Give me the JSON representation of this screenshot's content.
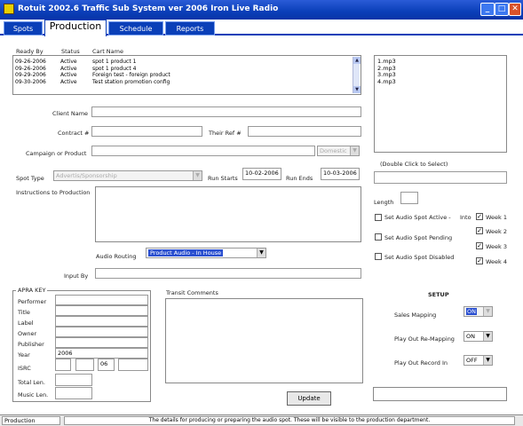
{
  "window": {
    "title": "Rotuit 2002.6 Traffic Sub System ver 2006 Iron Live Radio",
    "min": "_",
    "max": "□",
    "close": "✕"
  },
  "tabs": [
    {
      "label": "Spots"
    },
    {
      "label": "Production"
    },
    {
      "label": "Schedule"
    },
    {
      "label": "Reports"
    }
  ],
  "spot_list": {
    "headers": [
      "Ready By",
      "Status",
      "Cart Name"
    ],
    "rows": [
      [
        "09-26-2006",
        "Active",
        "spot 1 product 1"
      ],
      [
        "09-26-2006",
        "Active",
        "spot 1 product 4"
      ],
      [
        "09-29-2006",
        "Active",
        "Foreign test - foreign product"
      ],
      [
        "09-30-2006",
        "Active",
        "Test station promotion config"
      ]
    ]
  },
  "files": [
    "1.mp3",
    "2.mp3",
    "3.mp3",
    "4.mp3"
  ],
  "form": {
    "client_name_label": "Client Name",
    "contract_label": "Contract #",
    "their_ref_label": "Their Ref #",
    "campaign_label": "Campaign or Product",
    "domestic_value": "Domestic",
    "spot_type_label": "Spot Type",
    "spot_type_value": "Advertis/Sponsorship",
    "run_starts_label": "Run Starts",
    "run_starts_value": "10-02-2006",
    "run_ends_label": "Run Ends",
    "run_ends_value": "10-03-2006",
    "instructions_label": "Instructions to Production",
    "audio_routing_label": "Audio Routing",
    "audio_routing_value": "Product Audio - In House",
    "input_by_label": "Input By"
  },
  "right_panel": {
    "double_click": "(Double Click to Select)",
    "length_label": "Length",
    "set_active_label": "Set Audio Spot Active -",
    "into_label": "Into",
    "set_pending_label": "Set Audio Spot Pending",
    "set_disabled_label": "Set Audio Spot Disabled",
    "week1": "Week 1",
    "week2": "Week 2",
    "week3": "Week 3",
    "week4": "Week 4",
    "check_mark": "✓"
  },
  "apra": {
    "title": "APRA KEY",
    "performer": "Performer",
    "title_label": "Title",
    "label": "Label",
    "owner": "Owner",
    "publisher": "Publisher",
    "year": "Year",
    "year_value": "2006",
    "isrc": "ISRC",
    "isrc_value": "06",
    "total_len": "Total Len.",
    "music_len": "Music Len."
  },
  "transit_label": "Transit Comments",
  "setup": {
    "title": "SETUP",
    "sales_mapping_label": "Sales Mapping",
    "sales_mapping_value": "ON",
    "play_rw_label": "Play Out Re-Mapping",
    "play_rw_value": "ON",
    "play_record_label": "Play Out Record In",
    "play_record_value": "OFF"
  },
  "update_label": "Update",
  "status": {
    "left": "Production",
    "message": "The details for producing or preparing the audio spot. These will be visible to the production department."
  }
}
